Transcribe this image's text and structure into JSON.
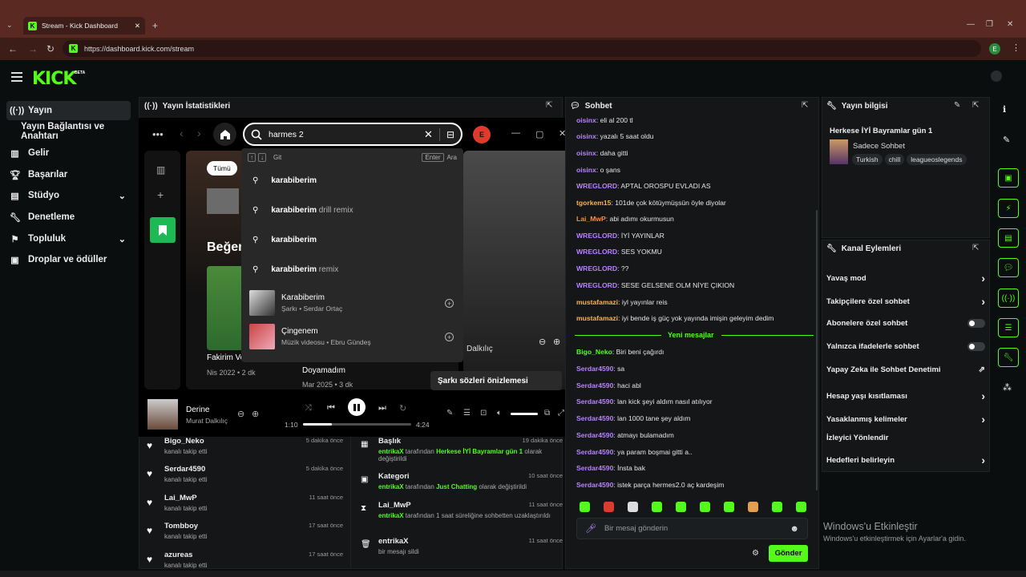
{
  "browser": {
    "tab_title": "Stream - Kick Dashboard",
    "url": "https://dashboard.kick.com/stream",
    "profile_initial": "E"
  },
  "header": {
    "logo": "KICK",
    "logo_badge": "BETA"
  },
  "sidebar": {
    "items": [
      {
        "label": "Yayın",
        "icon": "broadcast-icon"
      },
      {
        "label": "Yayın Bağlantısı ve Anahtarı",
        "icon": ""
      },
      {
        "label": "Gelir",
        "icon": "chart-icon"
      },
      {
        "label": "Başarılar",
        "icon": "trophy-icon"
      },
      {
        "label": "Stüdyo",
        "icon": "studio-icon"
      },
      {
        "label": "Denetleme",
        "icon": "wrench-icon"
      },
      {
        "label": "Topluluk",
        "icon": "community-icon"
      },
      {
        "label": "Droplar ve ödüller",
        "icon": "drops-icon"
      }
    ]
  },
  "stats_panel": {
    "title": "Yayın İstatistikleri"
  },
  "spotify": {
    "search_value": "harmes 2",
    "avatar_initial": "E",
    "nav_hint": "Git",
    "enter_key": "Enter",
    "enter_action": "Ara",
    "filter_chip": "Tümü",
    "heading": "Beğen",
    "suggestions": [
      {
        "bold": "karabiberim",
        "rest": ""
      },
      {
        "bold": "karabiberim",
        "rest": " drill remix"
      },
      {
        "bold": "karabiberim",
        "rest": ""
      },
      {
        "bold": "karabiberim",
        "rest": " remix"
      }
    ],
    "track_results": [
      {
        "title": "Karabiberim",
        "sub": "Şarkı • Serdar Ortaç"
      },
      {
        "title": "Çingenem",
        "sub": "Müzik videosu • Ebru Gündeş"
      }
    ],
    "cards": [
      {
        "title": "Fakirim Ve ...",
        "sub": "Nis 2022 • 2 dk"
      },
      {
        "title": "Doyamadım",
        "sub": "Mar 2025 • 3 dk"
      }
    ],
    "side_artist": "Dalkılıç",
    "lyrics_preview": "Şarkı sözleri önizlemesi",
    "player": {
      "title": "Derine",
      "artist": "Murat Dalkılıç",
      "elapsed": "1:10",
      "total": "4:24",
      "progress": 0.27
    }
  },
  "followers": [
    {
      "name": "Bigo_Neko",
      "sub": "kanalı takip etti",
      "time": "5 dakika önce"
    },
    {
      "name": "Serdar4590",
      "sub": "kanalı takip etti",
      "time": "5 dakika önce"
    },
    {
      "name": "Lai_MwP",
      "sub": "kanalı takip etti",
      "time": "11 saat önce"
    },
    {
      "name": "Tombboy",
      "sub": "kanalı takip etti",
      "time": "17 saat önce"
    },
    {
      "name": "azureas",
      "sub": "kanalı takip etti",
      "time": "17 saat önce"
    }
  ],
  "mod_log": [
    {
      "name": "Başlık",
      "actor": "entrikaX",
      "text": " tarafından ",
      "hl": "Herkese İYİ Bayramlar gün 1",
      "text2": " olarak değiştirildi",
      "time": "19 dakika önce"
    },
    {
      "name": "Kategori",
      "actor": "entrikaX",
      "text": " tarafından ",
      "hl": "Just Chatting",
      "text2": " olarak değiştirildi",
      "time": "10 saat önce"
    },
    {
      "name": "Lai_MwP",
      "actor": "entrikaX",
      "text": " tarafından 1 saat süreliğine sohbetten uzaklaştırıldı",
      "hl": "",
      "text2": "",
      "time": "11 saat önce"
    },
    {
      "name": "entrikaX",
      "actor": "",
      "text": "bir mesajı sildi",
      "hl": "",
      "text2": "",
      "time": "11 saat önce"
    }
  ],
  "chat": {
    "title": "Sohbet",
    "new_messages": "Yeni mesajlar",
    "input_placeholder": "Bir mesaj gönderin",
    "send": "Gönder",
    "messages": [
      {
        "user": "oisinx",
        "color": "#b983ff",
        "text": ": eli al 200 tl"
      },
      {
        "user": "oisinx",
        "color": "#b983ff",
        "text": ": yazalı 5 saat oldu"
      },
      {
        "user": "oisinx",
        "color": "#b983ff",
        "text": ": daha gitti"
      },
      {
        "user": "oisinx",
        "color": "#b983ff",
        "text": ": o şans"
      },
      {
        "user": "WREGLORD",
        "color": "#b983ff",
        "text": ": APTAL OROSPU EVLADI AS"
      },
      {
        "user": "tgorkem15",
        "color": "#ffb347",
        "text": ": 101de çok kötüymüşsün öyle diyolar"
      },
      {
        "user": "Lai_MwP",
        "color": "#ff8c42",
        "text": ": abi adımı okurmusun"
      },
      {
        "user": "WREGLORD",
        "color": "#b983ff",
        "text": ": İYİ YAYINLAR"
      },
      {
        "user": "WREGLORD",
        "color": "#b983ff",
        "text": ": SES YOKMU"
      },
      {
        "user": "WREGLORD",
        "color": "#b983ff",
        "text": ": ??"
      },
      {
        "user": "WREGLORD",
        "color": "#b983ff",
        "text": ": SESE GELSENE OLM NİYE ÇIKION"
      },
      {
        "user": "mustafamazi",
        "color": "#ffb347",
        "text": ": iyl yayınlar reis"
      },
      {
        "user": "mustafamazi",
        "color": "#ffb347",
        "text": ": iyi bende iş güç yok yayında imişin geleyim dedim"
      },
      {
        "user": "Bigo_Neko",
        "color": "#53fc18",
        "text": ": Biri beni çağırdı"
      },
      {
        "user": "Serdar4590",
        "color": "#b983ff",
        "text": ": sa"
      },
      {
        "user": "Serdar4590",
        "color": "#b983ff",
        "text": ": haci abl"
      },
      {
        "user": "Serdar4590",
        "color": "#b983ff",
        "text": ": lan kick şeyi aldım nasıl atılıyor"
      },
      {
        "user": "Serdar4590",
        "color": "#b983ff",
        "text": ": lan 1000 tane şey aldım"
      },
      {
        "user": "Serdar4590",
        "color": "#b983ff",
        "text": ": atmayı bulamadım"
      },
      {
        "user": "Serdar4590",
        "color": "#b983ff",
        "text": ": ya param boşmai gitti a.."
      },
      {
        "user": "Serdar4590",
        "color": "#b983ff",
        "text": ": İnsta bak"
      },
      {
        "user": "Serdar4590",
        "color": "#b983ff",
        "text": ": istek parça hermes2.0 aç kardeşim"
      }
    ]
  },
  "stream_info": {
    "title": "Yayın bilgisi",
    "stream_title": "Herkese İYİ Bayramlar gün 1",
    "category": "Sadece Sohbet",
    "tags": [
      "Turkish",
      "chill",
      "leagueoslegends"
    ]
  },
  "channel_actions": {
    "title": "Kanal Eylemleri",
    "items": [
      {
        "label": "Yavaş mod",
        "control": "chevron"
      },
      {
        "label": "Takipçilere özel sohbet",
        "control": "chevron"
      },
      {
        "label": "Abonelere özel sohbet",
        "control": "toggle"
      },
      {
        "label": "Yalnızca ifadelerle sohbet",
        "control": "toggle"
      },
      {
        "label": "Yapay Zeka ile Sohbet Denetimi",
        "control": "external"
      },
      {
        "label": "Hesap yaşı kısıtlaması",
        "control": "chevron"
      },
      {
        "label": "Yasaklanmış kelimeler",
        "control": "chevron"
      },
      {
        "label": "İzleyici Yönlendir",
        "control": ""
      },
      {
        "label": "Hedefleri belirleyin",
        "control": "chevron"
      }
    ]
  },
  "windows_activation": {
    "line1": "Windows'u Etkinleştir",
    "line2": "Windows'u etkinleştirmek için Ayarlar'a gidin."
  },
  "colors": {
    "brand": "#53fc18",
    "panel": "#141618",
    "bg": "#0b0e0f",
    "browser": "#5a2a22"
  }
}
